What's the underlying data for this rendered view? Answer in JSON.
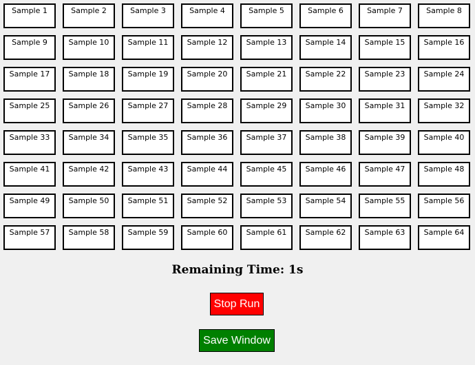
{
  "samples": [
    "Sample 1",
    "Sample 2",
    "Sample 3",
    "Sample 4",
    "Sample 5",
    "Sample 6",
    "Sample 7",
    "Sample 8",
    "Sample 9",
    "Sample 10",
    "Sample 11",
    "Sample 12",
    "Sample 13",
    "Sample 14",
    "Sample 15",
    "Sample 16",
    "Sample 17",
    "Sample 18",
    "Sample 19",
    "Sample 20",
    "Sample 21",
    "Sample 22",
    "Sample 23",
    "Sample 24",
    "Sample 25",
    "Sample 26",
    "Sample 27",
    "Sample 28",
    "Sample 29",
    "Sample 30",
    "Sample 31",
    "Sample 32",
    "Sample 33",
    "Sample 34",
    "Sample 35",
    "Sample 36",
    "Sample 37",
    "Sample 38",
    "Sample 39",
    "Sample 40",
    "Sample 41",
    "Sample 42",
    "Sample 43",
    "Sample 44",
    "Sample 45",
    "Sample 46",
    "Sample 47",
    "Sample 48",
    "Sample 49",
    "Sample 50",
    "Sample 51",
    "Sample 52",
    "Sample 53",
    "Sample 54",
    "Sample 55",
    "Sample 56",
    "Sample 57",
    "Sample 58",
    "Sample 59",
    "Sample 60",
    "Sample 61",
    "Sample 62",
    "Sample 63",
    "Sample 64"
  ],
  "timer": {
    "label": "Remaining Time: 1s"
  },
  "buttons": {
    "stop_label": "Stop Run",
    "stop_color": "#ff0000",
    "save_label": "Save Window",
    "save_color": "#008000"
  },
  "colors": {
    "background": "#f0f0f0",
    "sample_background": "#ffffff",
    "sample_border": "#000000"
  }
}
